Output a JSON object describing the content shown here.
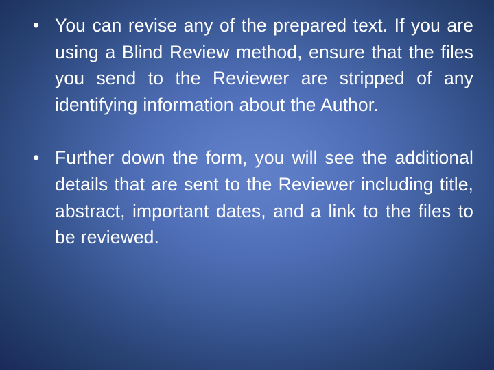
{
  "slide": {
    "background": {
      "type": "radial-gradient",
      "center_color": "#6180c8",
      "edge_color": "#1a2757"
    },
    "text_color": "#ffffff",
    "bullet_glyph": "•",
    "paragraphs": [
      {
        "id": "para-1",
        "bullet": "•",
        "lines": [
          "You can revise any of the prepared text.",
          "If you are using a Blind Review method,",
          "ensure that the files you send to the Reviewer",
          "are stripped of any identifying",
          "information about the Author."
        ],
        "text": "You can revise any of the prepared text. If you are using a Blind Review method, ensure that the files you send to the Reviewer are stripped of any identifying information about the Author."
      },
      {
        "id": "para-2",
        "bullet": "•",
        "lines": [
          "Further down the form, you will see the",
          "additional details that are sent to the",
          "Reviewer including title, abstract, important",
          "dates, and a link to the files to be reviewed."
        ],
        "text": "Further down the form, you will see the additional details that are sent to the Reviewer including title, abstract, important dates, and a link to the files to be reviewed."
      }
    ]
  }
}
